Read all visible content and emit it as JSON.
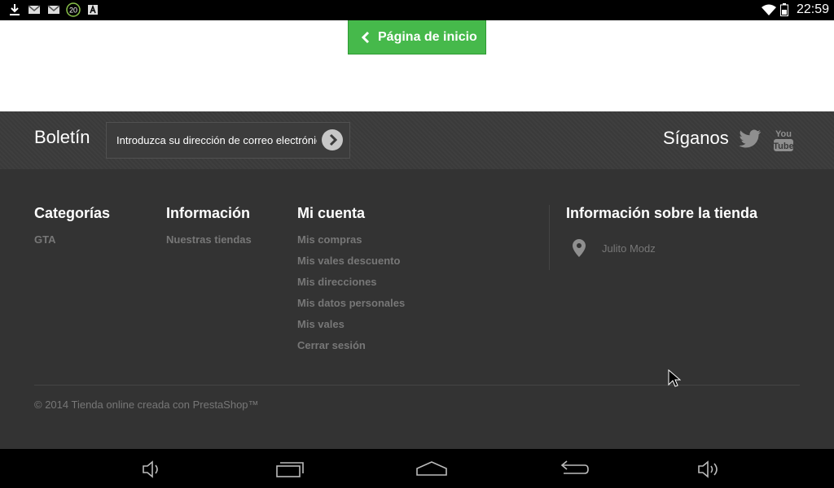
{
  "status_bar": {
    "time": "22:59",
    "notification_badge": "20",
    "icons": [
      "download-icon",
      "gmail-icon",
      "gmail-icon",
      "badge-20-icon",
      "a-icon",
      "wifi-icon",
      "battery-icon"
    ]
  },
  "page": {
    "home_button_label": "Página de inicio"
  },
  "newsletter": {
    "title": "Boletín",
    "placeholder": "Introduzca su dirección de correo electrónico"
  },
  "social": {
    "title": "Síganos",
    "icons": [
      "twitter-icon",
      "youtube-icon"
    ]
  },
  "footer": {
    "columns": [
      {
        "title": "Categorías",
        "items": [
          "GTA"
        ]
      },
      {
        "title": "Información",
        "items": [
          "Nuestras tiendas"
        ]
      },
      {
        "title": "Mi cuenta",
        "items": [
          "Mis compras",
          "Mis vales descuento",
          "Mis direcciones",
          "Mis datos personales",
          "Mis vales",
          "Cerrar sesión"
        ]
      }
    ],
    "store": {
      "title": "Información sobre la tienda",
      "name": "Julito Modz"
    },
    "copyright": "© 2014 Tienda online creada con PrestaShop™"
  },
  "nav_bar": {
    "buttons": [
      "volume-down-icon",
      "recent-apps-icon",
      "home-icon",
      "back-icon",
      "volume-up-icon"
    ]
  },
  "colors": {
    "accent_green": "#46b94b",
    "footer_bg": "#333333",
    "newsletter_bg": "#3a3a3a",
    "muted_text": "#777777"
  }
}
